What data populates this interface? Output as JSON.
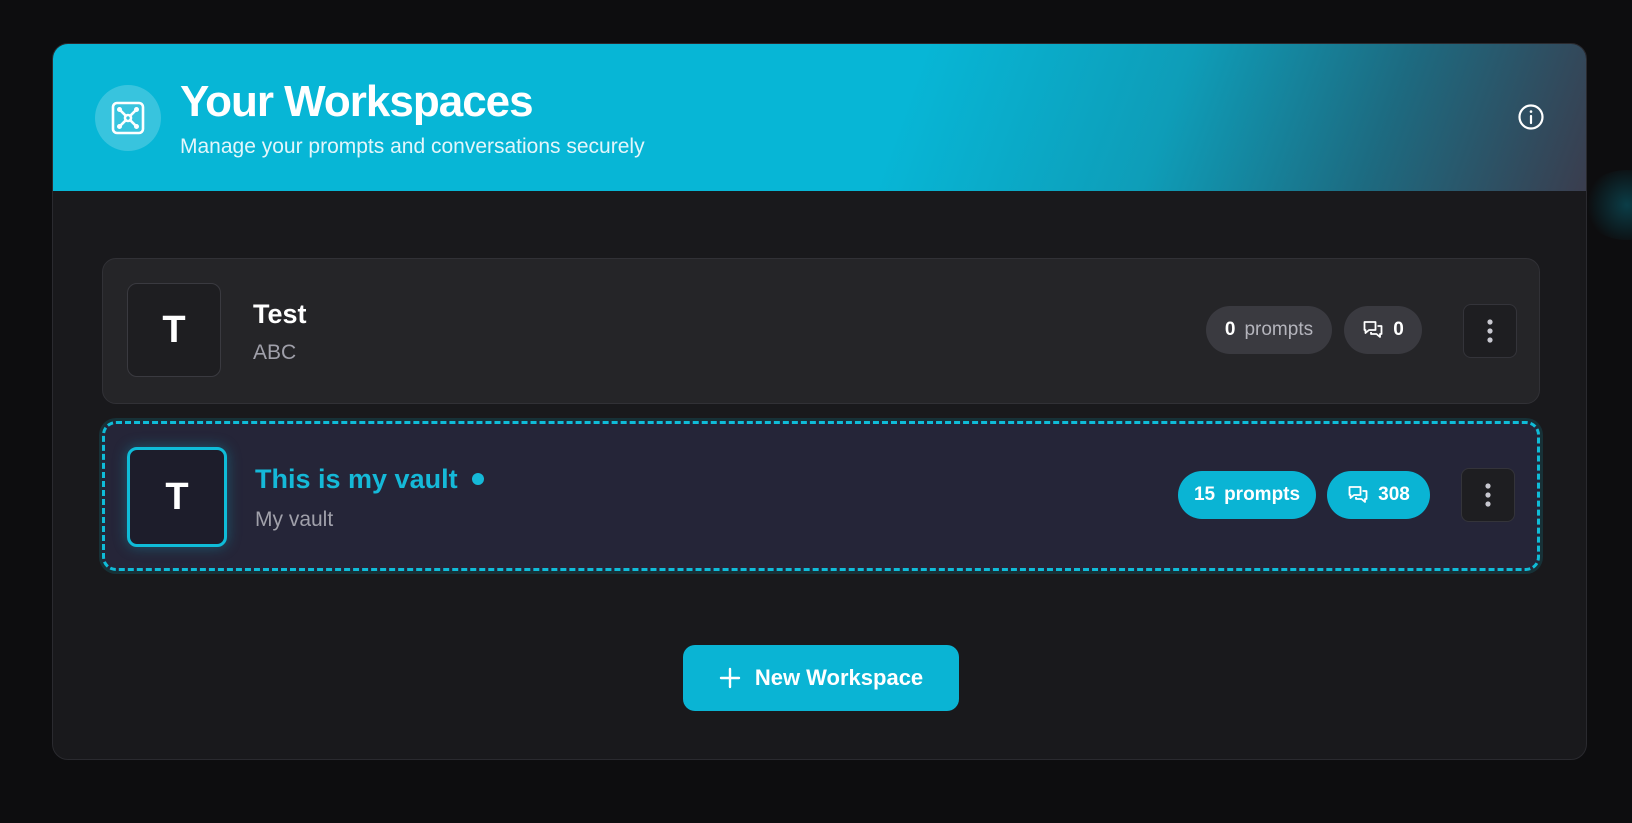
{
  "header": {
    "title": "Your Workspaces",
    "subtitle": "Manage your prompts and conversations securely",
    "logo_icon": "vault-icon",
    "info_icon": "info-icon"
  },
  "workspaces": [
    {
      "initial": "T",
      "name": "Test",
      "description": "ABC",
      "prompts_count": "0",
      "prompts_label": "prompts",
      "conversations_count": "0",
      "active": false
    },
    {
      "initial": "T",
      "name": "This is my vault",
      "description": "My vault",
      "prompts_count": "15",
      "prompts_label": "prompts",
      "conversations_count": "308",
      "active": true
    }
  ],
  "new_workspace_button": {
    "label": "New Workspace",
    "icon": "plus-icon"
  },
  "colors": {
    "accent": "#0ab4d4",
    "background": "#0d0d0f",
    "panel": "#19191c",
    "card": "#252528",
    "active_card": "#252538"
  }
}
